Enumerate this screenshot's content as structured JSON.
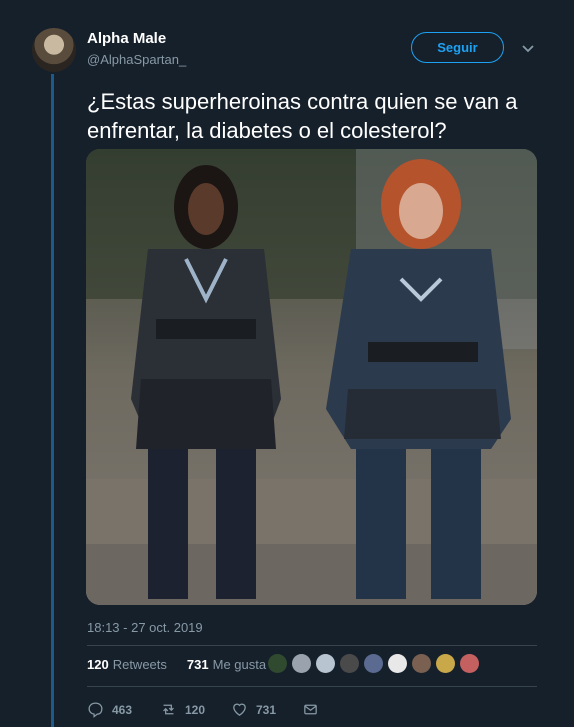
{
  "author": {
    "name": "Alpha Male",
    "handle": "@AlphaSpartan_"
  },
  "follow_label": "Seguir",
  "tweet_text": "¿Estas superheroinas contra quien se van a enfrentar, la diabetes o el colesterol?",
  "timestamp": "18:13 - 27 oct. 2019",
  "stats": {
    "retweets_count": "120",
    "retweets_label": "Retweets",
    "likes_count": "731",
    "likes_label": "Me gusta"
  },
  "actions": {
    "reply_count": "463",
    "retweet_count": "120",
    "like_count": "731"
  },
  "colors": {
    "background": "#15202b",
    "accent": "#1da1f2",
    "muted": "#8899a6"
  },
  "liker_avatar_colors": [
    "#2f4a2f",
    "#9aa3ad",
    "#b8c4cf",
    "#4a4a4a",
    "#5a6a90",
    "#e8e8e8",
    "#7a6050",
    "#c9a84a",
    "#c46060"
  ]
}
